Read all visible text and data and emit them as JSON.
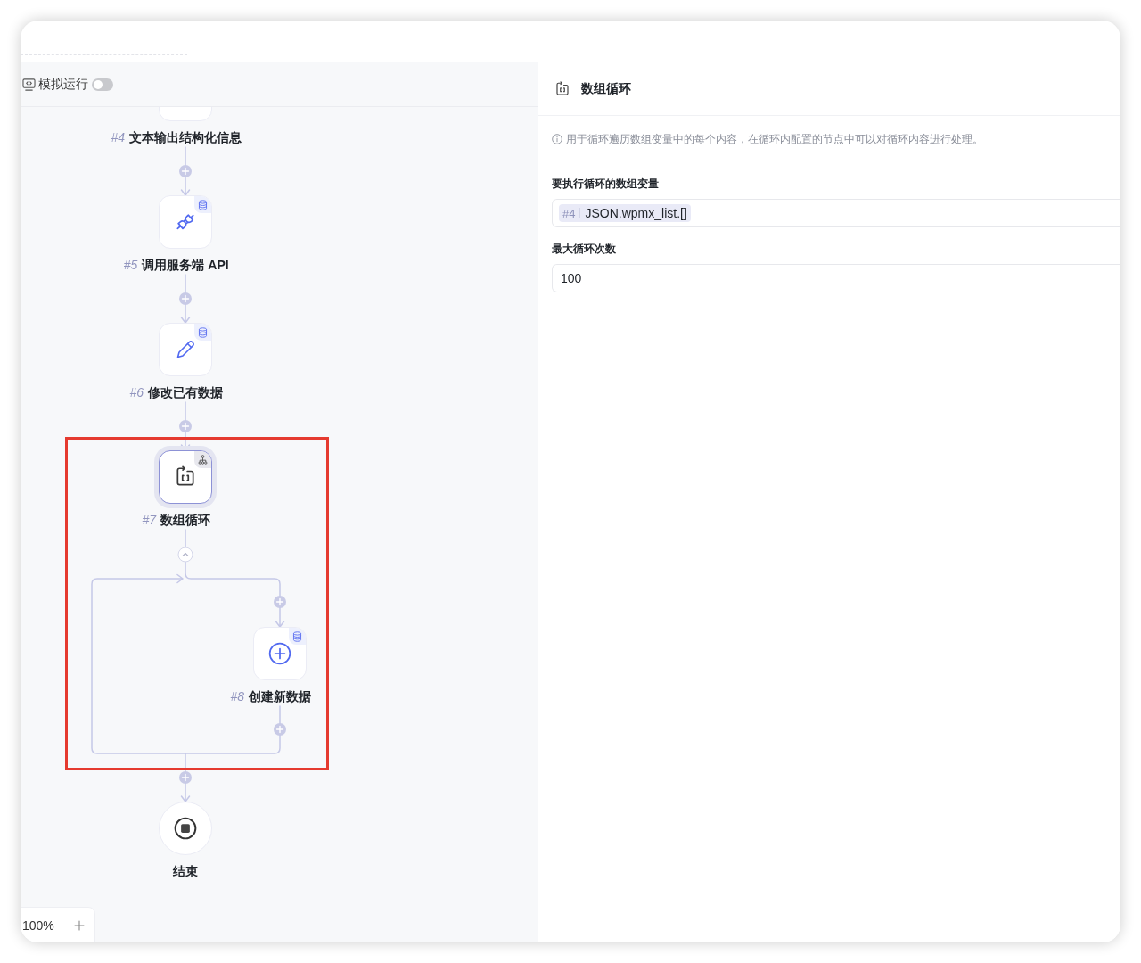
{
  "canvas": {
    "simulate": {
      "label": "模拟运行",
      "on": false
    },
    "flow": [
      {
        "kind": "text-output",
        "number": "#4",
        "label": "文本输出结构化信息",
        "selected": false
      },
      {
        "kind": "api-call",
        "number": "#5",
        "label": "调用服务端 API",
        "selected": false
      },
      {
        "kind": "update-data",
        "number": "#6",
        "label": "修改已有数据",
        "selected": false
      },
      {
        "kind": "loop",
        "number": "#7",
        "label": "数组循环",
        "selected": true,
        "highlighted": true,
        "expanded": true,
        "children": [
          {
            "kind": "create-data",
            "number": "#8",
            "label": "创建新数据",
            "selected": false
          }
        ]
      },
      {
        "kind": "end",
        "label": "结束",
        "selected": false
      }
    ],
    "zoom": {
      "value": "100%"
    }
  },
  "panel": {
    "title": "数组循环",
    "hint": "用于循环遍历数组变量中的每个内容，在循环内配置的节点中可以对循环内容进行处理。",
    "fields": [
      {
        "kind": "variable",
        "label": "要执行循环的数组变量",
        "ref": "#4",
        "value": "JSON.wpmx_list.[]"
      },
      {
        "kind": "text",
        "label": "最大循环次数",
        "value": "100"
      }
    ]
  }
}
